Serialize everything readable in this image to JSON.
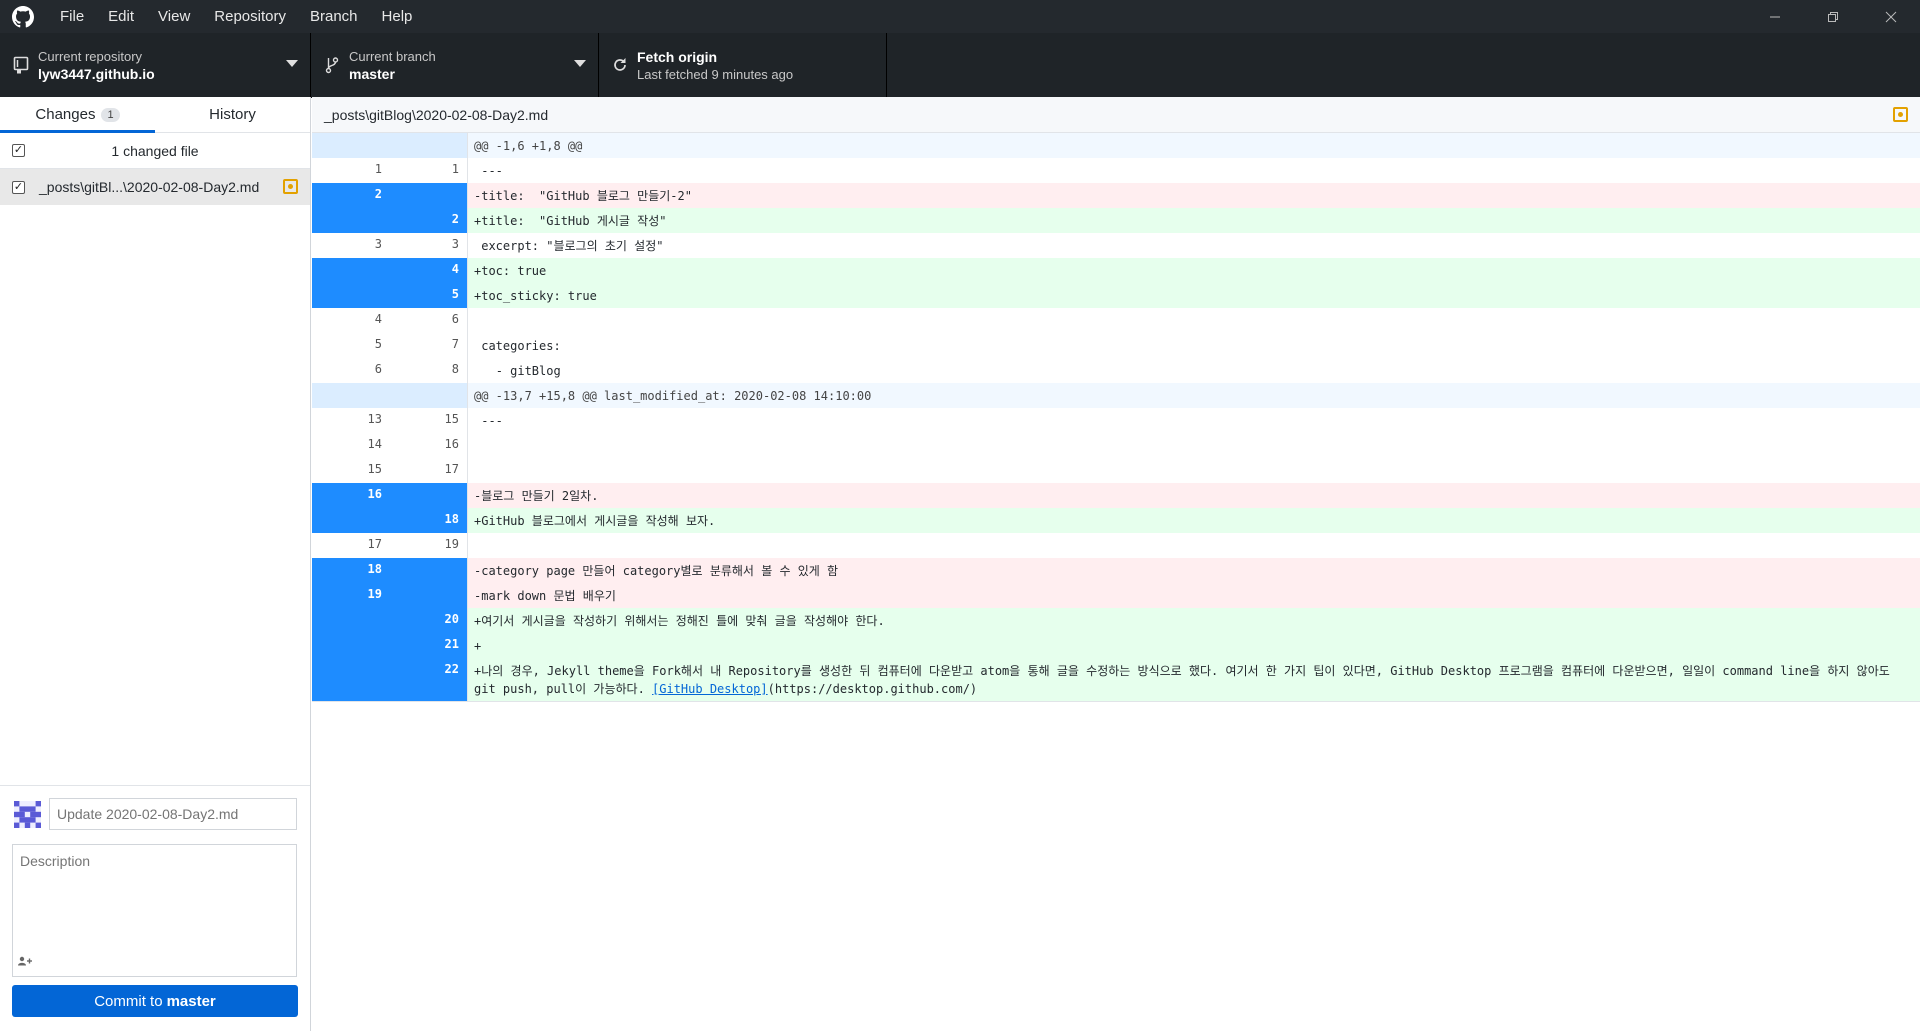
{
  "menu": [
    "File",
    "Edit",
    "View",
    "Repository",
    "Branch",
    "Help"
  ],
  "toolbar": {
    "repo_label": "Current repository",
    "repo_value": "lyw3447.github.io",
    "branch_label": "Current branch",
    "branch_value": "master",
    "fetch_title": "Fetch origin",
    "fetch_sub": "Last fetched 9 minutes ago"
  },
  "tabs": {
    "changes": "Changes",
    "changes_count": "1",
    "history": "History"
  },
  "changes": {
    "header": "1 changed file",
    "file": "_posts\\gitBl...\\2020-02-08-Day2.md"
  },
  "commit": {
    "summary_placeholder": "Update 2020-02-08-Day2.md",
    "description_placeholder": "Description",
    "button_prefix": "Commit to",
    "button_branch": "master"
  },
  "diff": {
    "path": "_posts\\gitBlog\\2020-02-08-Day2.md",
    "lines": [
      {
        "type": "hunk",
        "old": "",
        "new": "",
        "text": "@@ -1,6 +1,8 @@"
      },
      {
        "type": "ctx",
        "old": "1",
        "new": "1",
        "text": " ---"
      },
      {
        "type": "del",
        "old": "2",
        "new": "",
        "text": "-title:  \"GitHub 블로그 만들기-2\""
      },
      {
        "type": "add",
        "old": "",
        "new": "2",
        "text": "+title:  \"GitHub 게시글 작성\""
      },
      {
        "type": "ctx",
        "old": "3",
        "new": "3",
        "text": " excerpt: \"블로그의 초기 설정\""
      },
      {
        "type": "add",
        "old": "",
        "new": "4",
        "text": "+toc: true"
      },
      {
        "type": "add",
        "old": "",
        "new": "5",
        "text": "+toc_sticky: true"
      },
      {
        "type": "ctx",
        "old": "4",
        "new": "6",
        "text": " "
      },
      {
        "type": "ctx",
        "old": "5",
        "new": "7",
        "text": " categories:"
      },
      {
        "type": "ctx",
        "old": "6",
        "new": "8",
        "text": "   - gitBlog"
      },
      {
        "type": "hunk",
        "old": "",
        "new": "",
        "text": "@@ -13,7 +15,8 @@ last_modified_at: 2020-02-08 14:10:00"
      },
      {
        "type": "ctx",
        "old": "13",
        "new": "15",
        "text": " ---"
      },
      {
        "type": "ctx",
        "old": "14",
        "new": "16",
        "text": " "
      },
      {
        "type": "ctx",
        "old": "15",
        "new": "17",
        "text": " "
      },
      {
        "type": "del",
        "old": "16",
        "new": "",
        "text": "-블로그 만들기 2일차."
      },
      {
        "type": "add",
        "old": "",
        "new": "18",
        "text": "+GitHub 블로그에서 게시글을 작성해 보자."
      },
      {
        "type": "ctx",
        "old": "17",
        "new": "19",
        "text": " "
      },
      {
        "type": "del",
        "old": "18",
        "new": "",
        "text": "-category page 만들어 category별로 분류해서 볼 수 있게 함"
      },
      {
        "type": "del",
        "old": "19",
        "new": "",
        "text": "-mark down 문법 배우기"
      },
      {
        "type": "add",
        "old": "",
        "new": "20",
        "text": "+여기서 게시글을 작성하기 위해서는 정해진 틀에 맞춰 글을 작성해야 한다."
      },
      {
        "type": "add",
        "old": "",
        "new": "21",
        "text": "+"
      },
      {
        "type": "add",
        "old": "",
        "new": "22",
        "text": "+나의 경우, Jekyll theme을 Fork해서 내 Repository를 생성한 뒤 컴퓨터에 다운받고 atom을 통해 글을 수정하는 방식으로 했다. 여기서 한 가지 팁이 있다면, GitHub Desktop 프로그램을 컴퓨터에 다운받으면, 일일이 command line을 하지 않아도 git push, pull이 가능하다. ",
        "link_text": "[GitHub Desktop]",
        "link_tail": "(https://desktop.github.com/)"
      }
    ]
  },
  "colors": {
    "accent": "#0366d6",
    "selected_gutter": "#1e8cff",
    "added_bg": "#e6ffed",
    "deleted_bg": "#ffeef0",
    "hunk_bg": "#f1f8ff",
    "modified_icon": "#e3a100"
  },
  "icons": {
    "app": "github-mark-icon",
    "repo": "repository-icon",
    "branch": "branch-icon",
    "fetch": "sync-icon"
  }
}
